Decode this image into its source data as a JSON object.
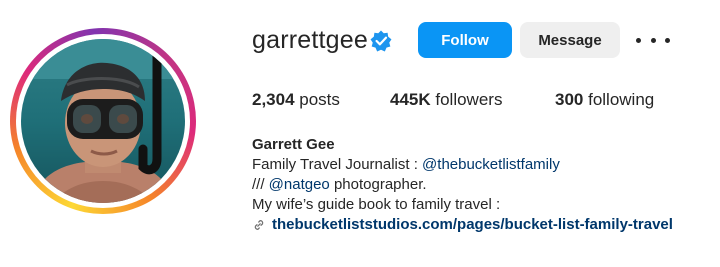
{
  "profile": {
    "username": "garrettgee",
    "verified": true,
    "follow_label": "Follow",
    "message_label": "Message",
    "more_icon": "more-options-icon",
    "accent_color": "#0a95f5"
  },
  "stats": {
    "posts_count": "2,304",
    "posts_label": " posts",
    "followers_count": "445K",
    "followers_label": " followers",
    "following_count": "300",
    "following_label": " following"
  },
  "bio": {
    "full_name": "Garrett Gee",
    "line1_text": "Family Travel Journalist : ",
    "line1_mention": "@thebucketlistfamily",
    "line2_prefix": "/// ",
    "line2_mention": "@natgeo",
    "line2_suffix": " photographer.",
    "line3_text": "My wife’s guide book to family travel :",
    "link_text": "thebucketliststudios.com/pages/bucket-list-family-travel",
    "link_icon": "link-icon"
  }
}
